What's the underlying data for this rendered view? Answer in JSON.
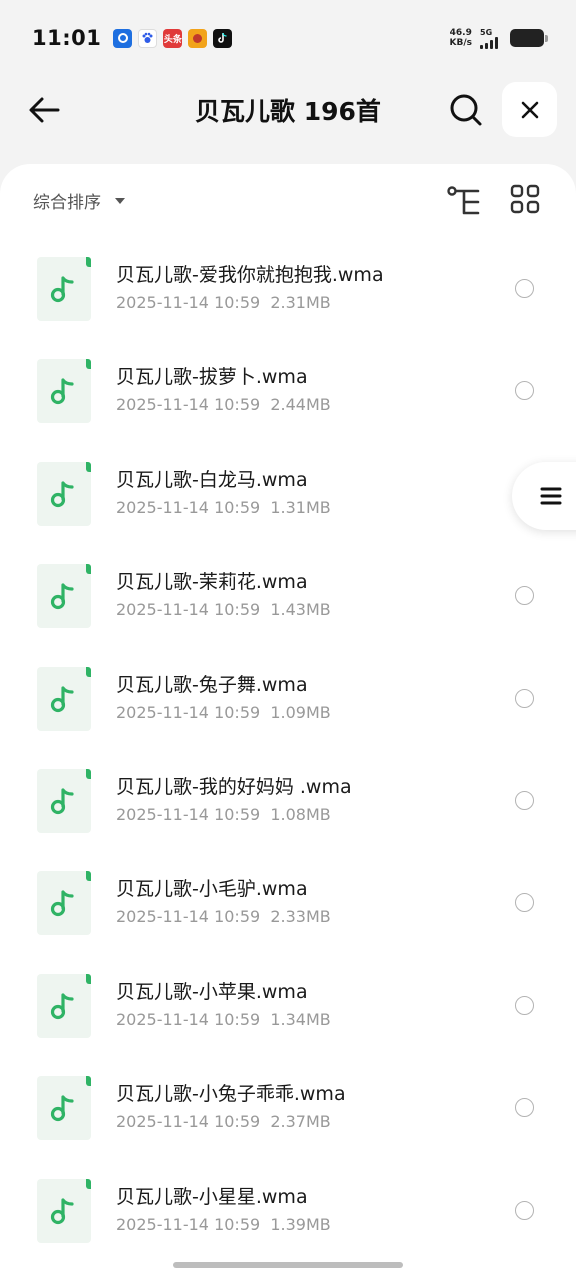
{
  "status_bar": {
    "time": "11:01",
    "net_speed_value": "46.9",
    "net_speed_unit": "KB/s",
    "network": "5G",
    "app_icons": [
      {
        "name": "app-icon-blue",
        "text": "",
        "color": "#1e6fe0"
      },
      {
        "name": "baidu-icon",
        "text": "",
        "color": "#2e5ce8"
      },
      {
        "name": "toutiao-icon",
        "text": "头条",
        "color": "#e03a3a"
      },
      {
        "name": "game-icon",
        "text": "",
        "color": "#f2a31a"
      },
      {
        "name": "tiktok-icon",
        "text": "",
        "color": "#111111"
      }
    ]
  },
  "header": {
    "title": "贝瓦儿歌 196首",
    "back_icon": "arrow-left-icon",
    "search_icon": "search-icon",
    "close_icon": "close-icon"
  },
  "toolbar": {
    "sort_label": "综合排序",
    "tree_icon": "tree-view-icon",
    "grid_icon": "grid-view-icon"
  },
  "files": [
    {
      "name": "贝瓦儿歌-爱我你就抱抱我.wma",
      "date": "2025-11-14 10:59",
      "size": "2.31MB"
    },
    {
      "name": "贝瓦儿歌-拔萝卜.wma",
      "date": "2025-11-14 10:59",
      "size": "2.44MB"
    },
    {
      "name": "贝瓦儿歌-白龙马.wma",
      "date": "2025-11-14 10:59",
      "size": "1.31MB"
    },
    {
      "name": "贝瓦儿歌-茉莉花.wma",
      "date": "2025-11-14 10:59",
      "size": "1.43MB"
    },
    {
      "name": "贝瓦儿歌-兔子舞.wma",
      "date": "2025-11-14 10:59",
      "size": "1.09MB"
    },
    {
      "name": "贝瓦儿歌-我的好妈妈 .wma",
      "date": "2025-11-14 10:59",
      "size": "1.08MB"
    },
    {
      "name": "贝瓦儿歌-小毛驴.wma",
      "date": "2025-11-14 10:59",
      "size": "2.33MB"
    },
    {
      "name": "贝瓦儿歌-小苹果.wma",
      "date": "2025-11-14 10:59",
      "size": "1.34MB"
    },
    {
      "name": "贝瓦儿歌-小兔子乖乖.wma",
      "date": "2025-11-14 10:59",
      "size": "2.37MB"
    },
    {
      "name": "贝瓦儿歌-小星星.wma",
      "date": "2025-11-14 10:59",
      "size": "1.39MB"
    }
  ],
  "colors": {
    "accent_green": "#2fb365",
    "thumb_bg": "#eef5f0",
    "background": "#f3f3f3"
  }
}
